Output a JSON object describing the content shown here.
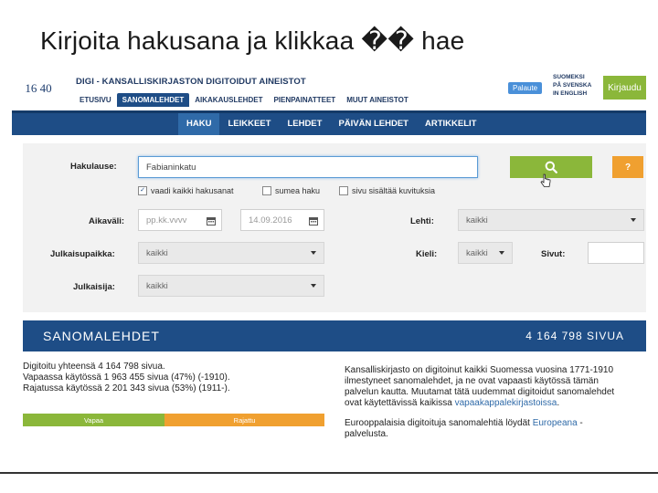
{
  "slide": {
    "title": "Kirjoita hakusana ja klikkaa �� hae"
  },
  "header": {
    "logo_text": "16 40",
    "site_title": "DIGI - KANSALLISKIRJASTON DIGITOIDUT AINEISTOT",
    "subnav": [
      "ETUSIVU",
      "SANOMALEHDET",
      "AIKAKAUSLEHDET",
      "PIENPAINATTEET",
      "MUUT AINEISTOT"
    ],
    "subnav_active": 1,
    "feedback_label": "Palaute",
    "lang_lines": [
      "SUOMEKSI",
      "PÅ SVENSKA",
      "IN ENGLISH"
    ],
    "login_label": "Kirjaudu"
  },
  "mainnav": {
    "items": [
      "HAKU",
      "LEIKKEET",
      "LEHDET",
      "PÄIVÄN LEHDET",
      "ARTIKKELIT"
    ],
    "active": 0
  },
  "form": {
    "query_label": "Hakulause:",
    "query_value": "Fabianinkatu",
    "help_label": "?",
    "checkboxes": [
      {
        "label": "vaadi kaikki hakusanat",
        "checked": true
      },
      {
        "label": "sumea haku",
        "checked": false
      },
      {
        "label": "sivu sisältää kuvituksia",
        "checked": false
      }
    ],
    "period_label": "Aikaväli:",
    "date_from_placeholder": "pp.kk.vvvv",
    "date_to_value": "14.09.2016",
    "paper_label": "Lehti:",
    "paper_value": "kaikki",
    "place_label": "Julkaisupaikka:",
    "place_value": "kaikki",
    "language_label": "Kieli:",
    "language_value": "kaikki",
    "pages_label": "Sivut:",
    "publisher_label": "Julkaisija:",
    "publisher_value": "kaikki"
  },
  "results": {
    "title": "SANOMALEHDET",
    "count": "4 164 798 SIVUA",
    "stats": [
      "Digitoitu yhteensä 4 164 798 sivua.",
      "Vapaassa käytössä 1 963 455 sivua (47%) (-1910).",
      "Rajatussa käytössä 2 201 343 sivua (53%) (1911-)."
    ],
    "bar_free_label": "Vapaa",
    "bar_restricted_label": "Rajattu",
    "bar_free_percent": 47,
    "info_p1_text": "Kansalliskirjasto on digitoinut kaikki Suomessa vuosina 1771-1910 ilmestyneet sanomalehdet, ja ne ovat vapaasti käytössä tämän palvelun kautta. Muutamat tätä uudemmat digitoidut sanomalehdet ovat käytettävissä kaikissa",
    "info_p1_link": "vapaakappalekirjastoissa",
    "info_p1_end": ".",
    "info_p2_text": "Eurooppalaisia digitoituja sanomalehtiä löydät",
    "info_p2_link": "Europeana",
    "info_p2_end": "-palvelusta."
  },
  "colors": {
    "navy": "#1e4d86",
    "green": "#8bb73a",
    "orange": "#f0a030"
  }
}
